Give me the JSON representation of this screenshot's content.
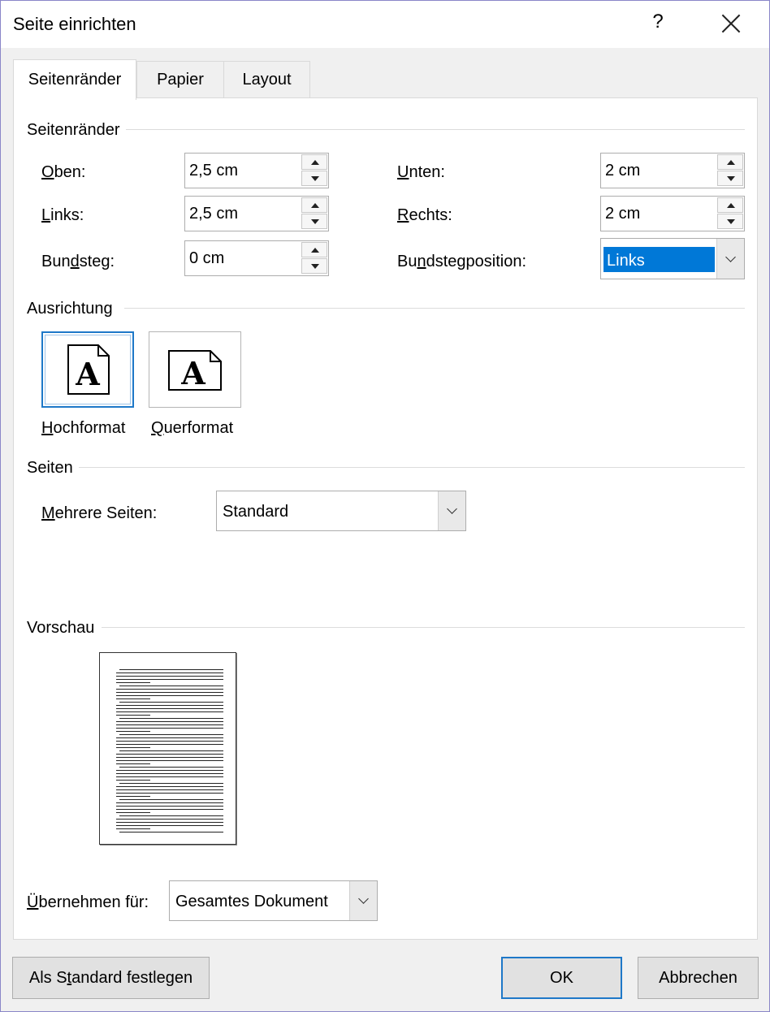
{
  "window": {
    "title": "Seite einrichten",
    "help_label": "?"
  },
  "tabs": [
    {
      "label": "Seitenränder"
    },
    {
      "label": "Papier"
    },
    {
      "label": "Layout"
    }
  ],
  "margins": {
    "section_title": "Seitenränder",
    "oben": {
      "label": "Oben:",
      "value": "2,5 cm"
    },
    "unten": {
      "label": "Unten:",
      "value": "2 cm"
    },
    "links": {
      "label": "Links:",
      "value": "2,5 cm"
    },
    "rechts": {
      "label": "Rechts:",
      "value": "2 cm"
    },
    "bundsteg": {
      "label": "Bundsteg:",
      "value": "0 cm"
    },
    "bundstegposition": {
      "label": "Bundstegposition:",
      "value": "Links"
    }
  },
  "orientation": {
    "section_title": "Ausrichtung",
    "portrait_label": "Hochformat",
    "landscape_label": "Querformat",
    "selected": "Hochformat"
  },
  "pages": {
    "section_title": "Seiten",
    "multiple_label": "Mehrere Seiten:",
    "multiple_value": "Standard"
  },
  "preview": {
    "section_title": "Vorschau"
  },
  "apply": {
    "label": "Übernehmen für:",
    "value": "Gesamtes Dokument"
  },
  "buttons": {
    "set_default": "Als Standard festlegen",
    "ok": "OK",
    "cancel": "Abbrechen"
  },
  "colors": {
    "accent": "#1e78c8",
    "selection": "#0078d7"
  }
}
